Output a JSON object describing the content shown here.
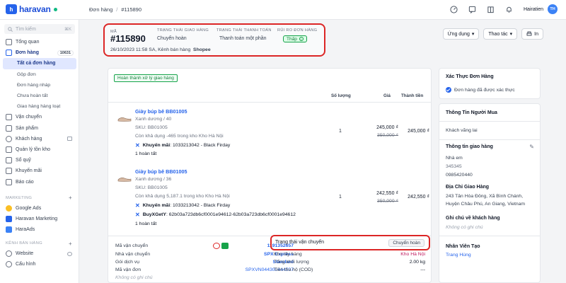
{
  "brand": {
    "name": "haravan"
  },
  "breadcrumb": {
    "parent": "Đơn hàng",
    "current": "#115890"
  },
  "user": {
    "name": "Hairatien",
    "initials": "TH"
  },
  "sidebar": {
    "search_placeholder": "Tìm kiếm",
    "search_shortcut": "⌘K",
    "items": [
      {
        "label": "Tổng quan"
      },
      {
        "label": "Đơn hàng",
        "badge": "10631"
      },
      {
        "label": "Tất cả đơn hàng"
      },
      {
        "label": "Gộp đơn"
      },
      {
        "label": "Đơn hàng nháp"
      },
      {
        "label": "Chưa hoàn tất"
      },
      {
        "label": "Giao hàng hàng loạt"
      },
      {
        "label": "Vận chuyển"
      },
      {
        "label": "Sản phẩm"
      },
      {
        "label": "Khách hàng"
      },
      {
        "label": "Quản lý tồn kho"
      },
      {
        "label": "Sổ quỹ"
      },
      {
        "label": "Khuyến mãi"
      },
      {
        "label": "Báo cáo"
      }
    ],
    "section_marketing": "MARKETING",
    "marketing": [
      {
        "label": "Google Ads"
      },
      {
        "label": "Haravan Marketing"
      },
      {
        "label": "HaraAds"
      }
    ],
    "section_channels": "KÊNH BÁN HÀNG",
    "channels": [
      {
        "label": "Website"
      },
      {
        "label": "Cấu hình"
      }
    ]
  },
  "order": {
    "code_label": "MÃ",
    "code": "#115890",
    "delivery_label": "TRẠNG THÁI GIAO HÀNG",
    "delivery_value": "Chuyển hoàn",
    "payment_label": "TRẠNG THÁI THANH TOÁN",
    "payment_value": "Thanh toán một phần",
    "risk_label": "RỦI RO ĐƠN HÀNG",
    "risk_value": "Thấp",
    "meta": "26/10/2023 11:58 SA, Kênh bán hàng",
    "channel": "Shopee"
  },
  "actions": {
    "apps": "Ứng dụng",
    "ops": "Thao tác",
    "print": "In"
  },
  "fulfillment": {
    "status": "Hoàn thành xử lý giao hàng",
    "col_qty": "Số lượng",
    "col_price": "Giá",
    "col_total": "Thành tiền",
    "items": [
      {
        "name": "Giày búp bê BB01005",
        "variant": "Xanh dương / 40",
        "sku": "SKU: BB01005",
        "stock": "Còn khả dụng -465 trong kho Kho Hà Nội",
        "promos": [
          {
            "label": "Khuyến mãi",
            "value": ": 1033213042 - Black Firday"
          }
        ],
        "qty": "1",
        "price": "245,000 ₫",
        "old_price": "350,000 ₫",
        "total": "245,000 ₫",
        "done": "1 hoàn tất"
      },
      {
        "name": "Giày búp bê BB01005",
        "variant": "Xanh dương / 36",
        "sku": "SKU: BB01005",
        "stock": "Còn khả dụng 5,187.1 trong kho Kho Hà Nội",
        "promos": [
          {
            "label": "Khuyến mãi",
            "value": ": 1033213042 - Black Firday"
          },
          {
            "label": "BuyXGetY",
            "value": ": 62b03a723db6cf0001e94612-62b03a723db6cf0001e94612"
          }
        ],
        "qty": "1",
        "price": "242,550 ₫",
        "old_price": "350,000 ₫",
        "total": "242,550 ₫",
        "done": "1 hoàn tất"
      }
    ],
    "shipping": {
      "tracking_label": "Mã vận chuyển",
      "tracking_value": "1191352657",
      "carrier_label": "Nhà vận chuyển",
      "carrier_value": "SPX Express",
      "service_label": "Gói dịch vụ",
      "service_value": "Standard",
      "order_code_label": "Mã vận đơn",
      "order_code_value": "SPXVN044300444597",
      "note": "Không có ghi chú",
      "status_label": "Trạng thái vận chuyển",
      "status_value": "Chuyển hoàn",
      "warehouse_label": "Kho lấy hàng",
      "warehouse_value": "Kho Hà Nội",
      "weight_label": "Tổng khối lượng",
      "weight_value": "2.00 kg",
      "cod_label": "Tiền thu hộ (COD)",
      "cod_value": "---"
    }
  },
  "right": {
    "verify_title": "Xác Thực Đơn Hàng",
    "verify_text": "Đơn hàng đã được xác thực",
    "buyer_title": "Thông Tin Người Mua",
    "buyer_text": "Khách vãng lai",
    "ship_title": "Thông tin giao hàng",
    "ship_name": "Nhà em",
    "ship_phone1": "345345",
    "ship_phone2": "0985420440",
    "addr_title": "Địa Chỉ Giao Hàng",
    "addr_line1": "243 Tân Hòa Đông, Xã Bình Chánh,",
    "addr_line2": "Huyện Châu Phú, An Giang, Vietnam",
    "note_title": "Ghi chú về khách hàng",
    "note_text": "Không có ghi chú",
    "staff_title": "Nhân Viên Tạo",
    "staff_name": "Trang Hùng"
  },
  "colors": {
    "accent": "#2563eb",
    "highlight": "#dc2626",
    "success": "#16a34a"
  }
}
